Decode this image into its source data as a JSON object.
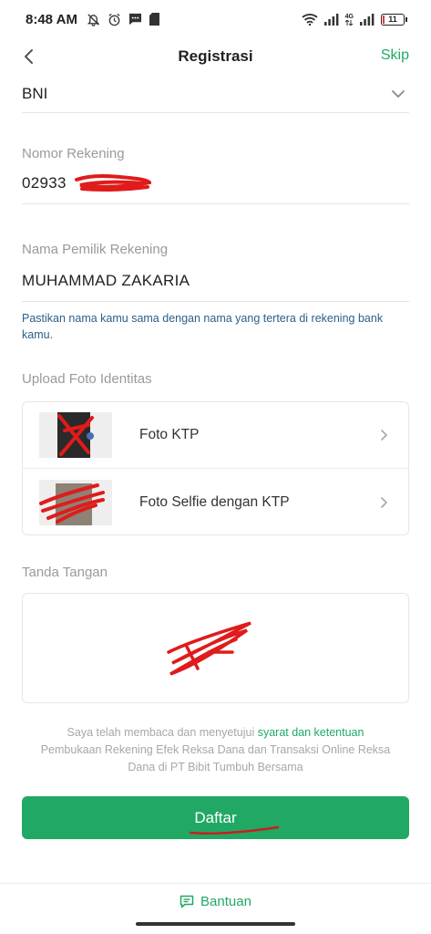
{
  "status_bar": {
    "time": "8:48 AM",
    "icons": [
      "notification-off-icon",
      "alarm-icon",
      "message-icon",
      "sd-card-icon"
    ],
    "network_label_top": "4G",
    "battery_level": "11"
  },
  "header": {
    "title": "Registrasi",
    "skip_label": "Skip"
  },
  "bank": {
    "value": "BNI"
  },
  "account_number": {
    "label": "Nomor Rekening",
    "value": "02933"
  },
  "account_holder": {
    "label": "Nama Pemilik Rekening",
    "value": "MUHAMMAD ZAKARIA"
  },
  "note": "Pastikan nama kamu sama dengan nama yang tertera di rekening bank kamu.",
  "upload": {
    "section_label": "Upload Foto Identitas",
    "items": [
      {
        "label": "Foto KTP"
      },
      {
        "label": "Foto Selfie dengan KTP"
      }
    ]
  },
  "signature": {
    "section_label": "Tanda Tangan"
  },
  "agreement": {
    "prefix": "Saya telah membaca dan menyetujui ",
    "link": "syarat dan ketentuan",
    "suffix": " Pembukaan Rekening Efek Reksa Dana dan Transaksi Online Reksa Dana di PT Bibit Tumbuh Bersama"
  },
  "submit_label": "Daftar",
  "footer": {
    "help_label": "Bantuan"
  },
  "colors": {
    "accent": "#21a865",
    "note_text": "#2a5f8a",
    "redaction": "#e01b1b"
  }
}
